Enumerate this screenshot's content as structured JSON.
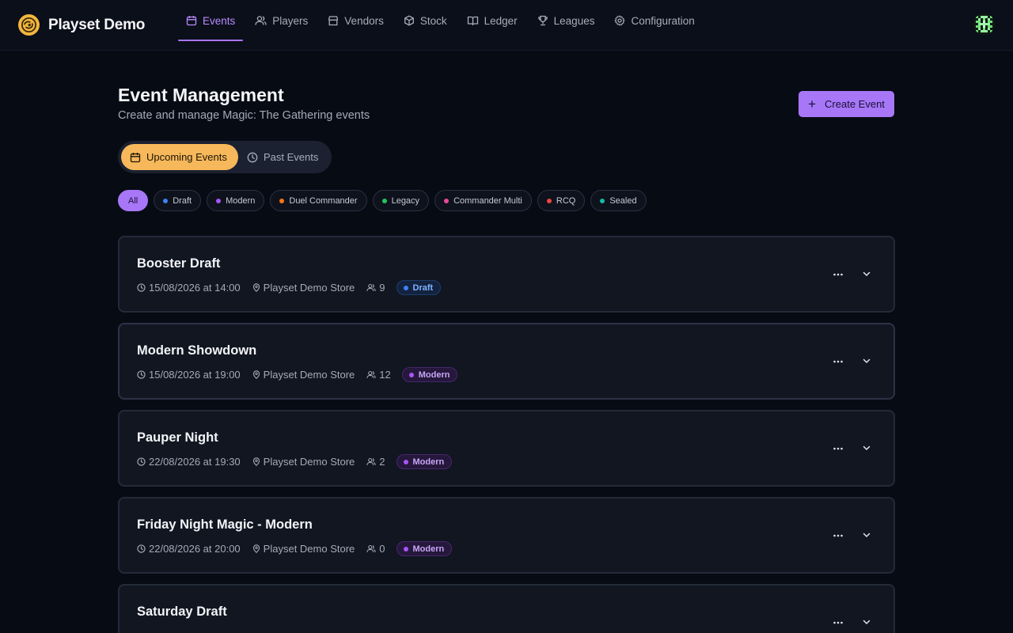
{
  "app": {
    "name": "Playset Demo"
  },
  "nav": {
    "items": [
      {
        "label": "Events",
        "icon": "calendar-icon",
        "active": true
      },
      {
        "label": "Players",
        "icon": "users-icon"
      },
      {
        "label": "Vendors",
        "icon": "store-icon"
      },
      {
        "label": "Stock",
        "icon": "box-icon"
      },
      {
        "label": "Ledger",
        "icon": "book-icon"
      },
      {
        "label": "Leagues",
        "icon": "trophy-icon"
      },
      {
        "label": "Configuration",
        "icon": "gear-icon"
      }
    ]
  },
  "header": {
    "title": "Event Management",
    "subtitle": "Create and manage Magic: The Gathering events",
    "create_label": "Create Event"
  },
  "tabs": {
    "upcoming": "Upcoming Events",
    "past": "Past Events",
    "selected": "Upcoming Events"
  },
  "filters": {
    "all": "All",
    "formats": [
      {
        "label": "Draft",
        "color": "#3b82f6"
      },
      {
        "label": "Modern",
        "color": "#a855f7"
      },
      {
        "label": "Duel Commander",
        "color": "#f97316"
      },
      {
        "label": "Legacy",
        "color": "#22c55e"
      },
      {
        "label": "Commander Multi",
        "color": "#ec4899"
      },
      {
        "label": "RCQ",
        "color": "#ef4444"
      },
      {
        "label": "Sealed",
        "color": "#14b8a6"
      }
    ]
  },
  "events": [
    {
      "title": "Booster Draft",
      "datetime": "15/08/2026 at 14:00",
      "location": "Playset Demo Store",
      "players": "9",
      "format": "Draft"
    },
    {
      "title": "Modern Showdown",
      "datetime": "15/08/2026 at 19:00",
      "location": "Playset Demo Store",
      "players": "12",
      "format": "Modern"
    },
    {
      "title": "Pauper Night",
      "datetime": "22/08/2026 at 19:30",
      "location": "Playset Demo Store",
      "players": "2",
      "format": "Modern"
    },
    {
      "title": "Friday Night Magic - Modern",
      "datetime": "22/08/2026 at 20:00",
      "location": "Playset Demo Store",
      "players": "0",
      "format": "Modern"
    },
    {
      "title": "Saturday Draft",
      "datetime": "",
      "location": "",
      "players": "",
      "format": ""
    }
  ],
  "colors": {
    "accent": "#a777f8",
    "upcoming_tab": "#f6b85a",
    "background": "#070b14"
  }
}
